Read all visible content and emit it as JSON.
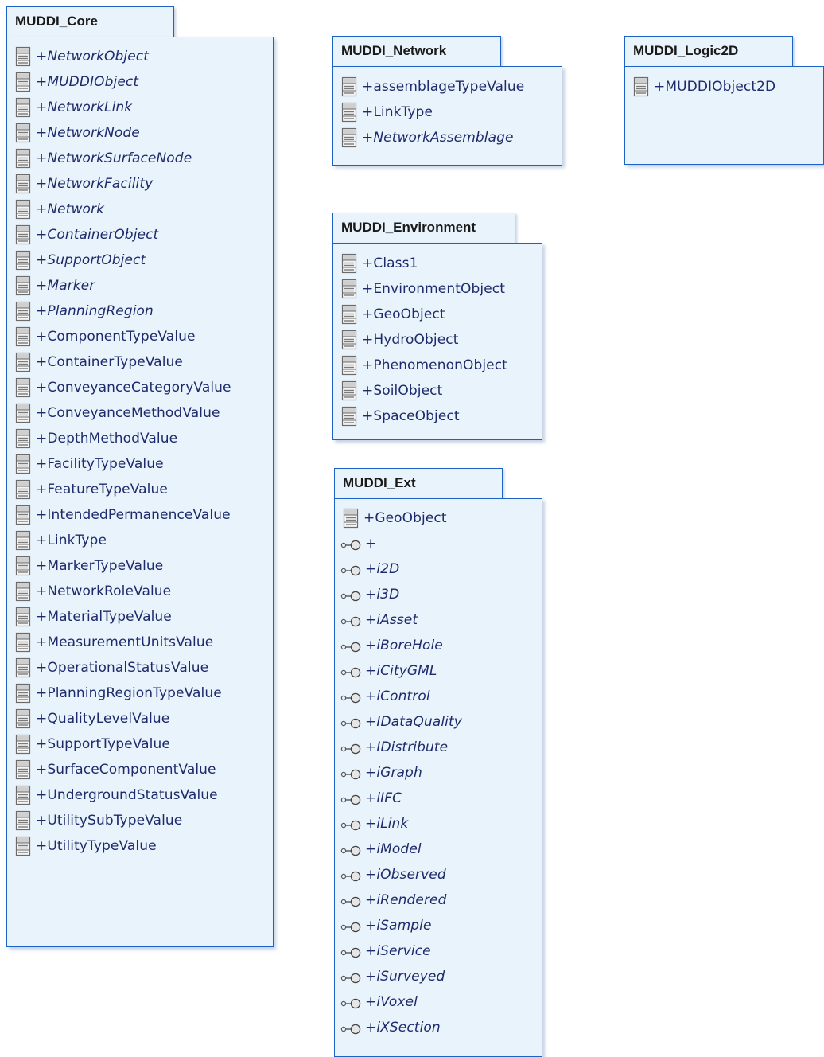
{
  "packages": {
    "core": {
      "title": "MUDDI_Core",
      "items": [
        {
          "label": "+NetworkObject",
          "italic": true,
          "icon": "class-icon"
        },
        {
          "label": "+MUDDIObject",
          "italic": true,
          "icon": "class-icon"
        },
        {
          "label": "+NetworkLink",
          "italic": true,
          "icon": "class-icon"
        },
        {
          "label": "+NetworkNode",
          "italic": true,
          "icon": "class-icon"
        },
        {
          "label": "+NetworkSurfaceNode",
          "italic": true,
          "icon": "class-icon"
        },
        {
          "label": "+NetworkFacility",
          "italic": true,
          "icon": "class-icon"
        },
        {
          "label": "+Network",
          "italic": true,
          "icon": "class-icon"
        },
        {
          "label": "+ContainerObject",
          "italic": true,
          "icon": "class-icon"
        },
        {
          "label": "+SupportObject",
          "italic": true,
          "icon": "class-icon"
        },
        {
          "label": "+Marker",
          "italic": true,
          "icon": "class-icon"
        },
        {
          "label": "+PlanningRegion",
          "italic": true,
          "icon": "class-icon"
        },
        {
          "label": "+ComponentTypeValue",
          "italic": false,
          "icon": "class-icon"
        },
        {
          "label": "+ContainerTypeValue",
          "italic": false,
          "icon": "class-icon"
        },
        {
          "label": "+ConveyanceCategoryValue",
          "italic": false,
          "icon": "class-icon"
        },
        {
          "label": "+ConveyanceMethodValue",
          "italic": false,
          "icon": "class-icon"
        },
        {
          "label": "+DepthMethodValue",
          "italic": false,
          "icon": "class-icon"
        },
        {
          "label": "+FacilityTypeValue",
          "italic": false,
          "icon": "class-icon"
        },
        {
          "label": "+FeatureTypeValue",
          "italic": false,
          "icon": "class-icon"
        },
        {
          "label": "+IntendedPermanenceValue",
          "italic": false,
          "icon": "class-icon"
        },
        {
          "label": "+LinkType",
          "italic": false,
          "icon": "class-icon"
        },
        {
          "label": "+MarkerTypeValue",
          "italic": false,
          "icon": "class-icon"
        },
        {
          "label": "+NetworkRoleValue",
          "italic": false,
          "icon": "class-icon"
        },
        {
          "label": "+MaterialTypeValue",
          "italic": false,
          "icon": "class-icon"
        },
        {
          "label": "+MeasurementUnitsValue",
          "italic": false,
          "icon": "class-icon"
        },
        {
          "label": "+OperationalStatusValue",
          "italic": false,
          "icon": "class-icon"
        },
        {
          "label": "+PlanningRegionTypeValue",
          "italic": false,
          "icon": "class-icon"
        },
        {
          "label": "+QualityLevelValue",
          "italic": false,
          "icon": "class-icon"
        },
        {
          "label": "+SupportTypeValue",
          "italic": false,
          "icon": "class-icon"
        },
        {
          "label": "+SurfaceComponentValue",
          "italic": false,
          "icon": "class-icon"
        },
        {
          "label": "+UndergroundStatusValue",
          "italic": false,
          "icon": "class-icon"
        },
        {
          "label": "+UtilitySubTypeValue",
          "italic": false,
          "icon": "class-icon"
        },
        {
          "label": "+UtilityTypeValue",
          "italic": false,
          "icon": "class-icon"
        }
      ]
    },
    "network": {
      "title": "MUDDI_Network",
      "items": [
        {
          "label": "+assemblageTypeValue",
          "italic": false,
          "icon": "class-icon"
        },
        {
          "label": "+LinkType",
          "italic": false,
          "icon": "class-icon"
        },
        {
          "label": "+NetworkAssemblage",
          "italic": true,
          "icon": "class-icon"
        }
      ]
    },
    "logic2d": {
      "title": "MUDDI_Logic2D",
      "items": [
        {
          "label": "+MUDDIObject2D",
          "italic": false,
          "icon": "class-icon"
        }
      ]
    },
    "environment": {
      "title": "MUDDI_Environment",
      "items": [
        {
          "label": "+Class1",
          "italic": false,
          "icon": "class-icon"
        },
        {
          "label": "+EnvironmentObject",
          "italic": false,
          "icon": "class-icon"
        },
        {
          "label": "+GeoObject",
          "italic": false,
          "icon": "class-icon"
        },
        {
          "label": "+HydroObject",
          "italic": false,
          "icon": "class-icon"
        },
        {
          "label": "+PhenomenonObject",
          "italic": false,
          "icon": "class-icon"
        },
        {
          "label": "+SoilObject",
          "italic": false,
          "icon": "class-icon"
        },
        {
          "label": "+SpaceObject",
          "italic": false,
          "icon": "class-icon"
        }
      ]
    },
    "ext": {
      "title": "MUDDI_Ext",
      "items": [
        {
          "label": "+GeoObject",
          "italic": false,
          "icon": "class-icon"
        },
        {
          "label": "+",
          "italic": true,
          "icon": "interface-icon"
        },
        {
          "label": "+i2D",
          "italic": true,
          "icon": "interface-icon"
        },
        {
          "label": "+i3D",
          "italic": true,
          "icon": "interface-icon"
        },
        {
          "label": "+iAsset",
          "italic": true,
          "icon": "interface-icon"
        },
        {
          "label": "+iBoreHole",
          "italic": true,
          "icon": "interface-icon"
        },
        {
          "label": "+iCityGML",
          "italic": true,
          "icon": "interface-icon"
        },
        {
          "label": "+iControl",
          "italic": true,
          "icon": "interface-icon"
        },
        {
          "label": "+IDataQuality",
          "italic": true,
          "icon": "interface-icon"
        },
        {
          "label": "+IDistribute",
          "italic": true,
          "icon": "interface-icon"
        },
        {
          "label": "+iGraph",
          "italic": true,
          "icon": "interface-icon"
        },
        {
          "label": "+iIFC",
          "italic": true,
          "icon": "interface-icon"
        },
        {
          "label": "+iLink",
          "italic": true,
          "icon": "interface-icon"
        },
        {
          "label": "+iModel",
          "italic": true,
          "icon": "interface-icon"
        },
        {
          "label": "+iObserved",
          "italic": true,
          "icon": "interface-icon"
        },
        {
          "label": "+iRendered",
          "italic": true,
          "icon": "interface-icon"
        },
        {
          "label": "+iSample",
          "italic": true,
          "icon": "interface-icon"
        },
        {
          "label": "+iService",
          "italic": true,
          "icon": "interface-icon"
        },
        {
          "label": "+iSurveyed",
          "italic": true,
          "icon": "interface-icon"
        },
        {
          "label": "+iVoxel",
          "italic": true,
          "icon": "interface-icon"
        },
        {
          "label": "+iXSection",
          "italic": true,
          "icon": "interface-icon"
        }
      ]
    }
  },
  "colors": {
    "border": "#1d63c7",
    "fill": "#e9f3fb",
    "text": "#1d2a6b"
  }
}
